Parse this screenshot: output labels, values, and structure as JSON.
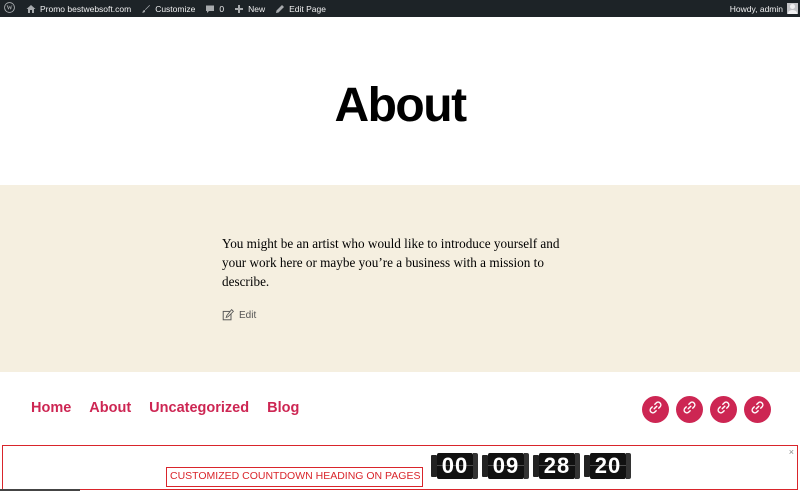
{
  "admin_bar": {
    "site_name": "Promo bestwebsoft.com",
    "customize": "Customize",
    "comments_count": "0",
    "new": "New",
    "edit_page": "Edit Page",
    "howdy": "Howdy, admin"
  },
  "page": {
    "title": "About",
    "intro": "You might be an artist who would like to introduce yourself and your work here or maybe you’re a business with a mission to describe.",
    "edit_label": "Edit"
  },
  "footer_nav": {
    "items": [
      "Home",
      "About",
      "Uncategorized",
      "Blog"
    ]
  },
  "social": {
    "icons": [
      "link-icon",
      "link-icon",
      "link-icon",
      "link-icon"
    ],
    "color": "#cd2653"
  },
  "countdown": {
    "heading": "CUSTOMIZED COUNTDOWN HEADING ON PAGES",
    "days": "00",
    "hours": "09",
    "minutes": "28",
    "seconds": "20",
    "close": "×",
    "border_color": "#d9252b"
  },
  "colors": {
    "accent": "#cd2653",
    "admin_bar_bg": "#1d2327",
    "band_bg": "#f5efe0"
  }
}
